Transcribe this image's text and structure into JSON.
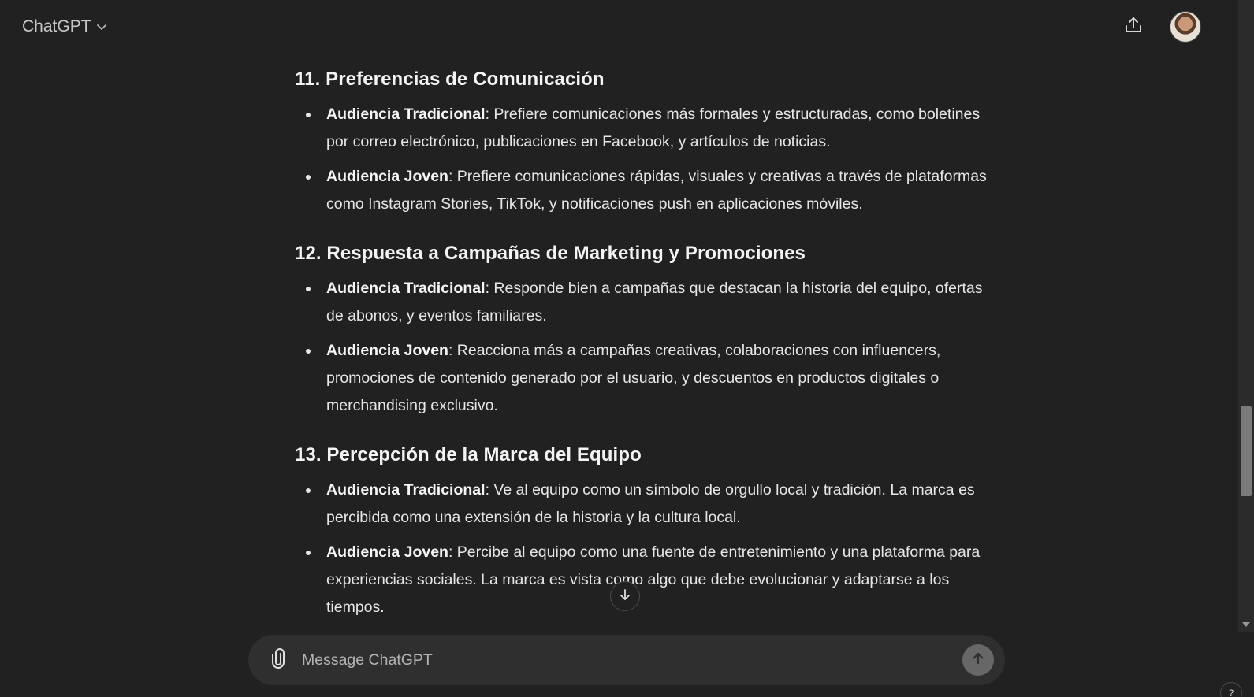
{
  "header": {
    "model_name": "ChatGPT",
    "share_icon": "share-upload-icon",
    "avatar": "user-avatar"
  },
  "sections": [
    {
      "title": "11. Preferencias de Comunicación",
      "items": [
        {
          "label": "Audiencia Tradicional",
          "text": ": Prefiere comunicaciones más formales y estructuradas, como boletines por correo electrónico, publicaciones en Facebook, y artículos de noticias."
        },
        {
          "label": "Audiencia Joven",
          "text": ": Prefiere comunicaciones rápidas, visuales y creativas a través de plataformas como Instagram Stories, TikTok, y notificaciones push en aplicaciones móviles."
        }
      ]
    },
    {
      "title": "12. Respuesta a Campañas de Marketing y Promociones",
      "items": [
        {
          "label": "Audiencia Tradicional",
          "text": ": Responde bien a campañas que destacan la historia del equipo, ofertas de abonos, y eventos familiares."
        },
        {
          "label": "Audiencia Joven",
          "text": ": Reacciona más a campañas creativas, colaboraciones con influencers, promociones de contenido generado por el usuario, y descuentos en productos digitales o merchandising exclusivo."
        }
      ]
    },
    {
      "title": "13. Percepción de la Marca del Equipo",
      "items": [
        {
          "label": "Audiencia Tradicional",
          "text": ": Ve al equipo como un símbolo de orgullo local y tradición. La marca es percibida como una extensión de la historia y la cultura local."
        },
        {
          "label": "Audiencia Joven",
          "text": ": Percibe al equipo como una fuente de entretenimiento y una plataforma para experiencias sociales. La marca es vista como algo que debe evolucionar y adaptarse a los tiempos."
        }
      ]
    }
  ],
  "composer": {
    "placeholder": "Message ChatGPT",
    "attach_icon": "paperclip-icon",
    "send_icon": "arrow-up-icon"
  },
  "help": {
    "label": "?"
  }
}
